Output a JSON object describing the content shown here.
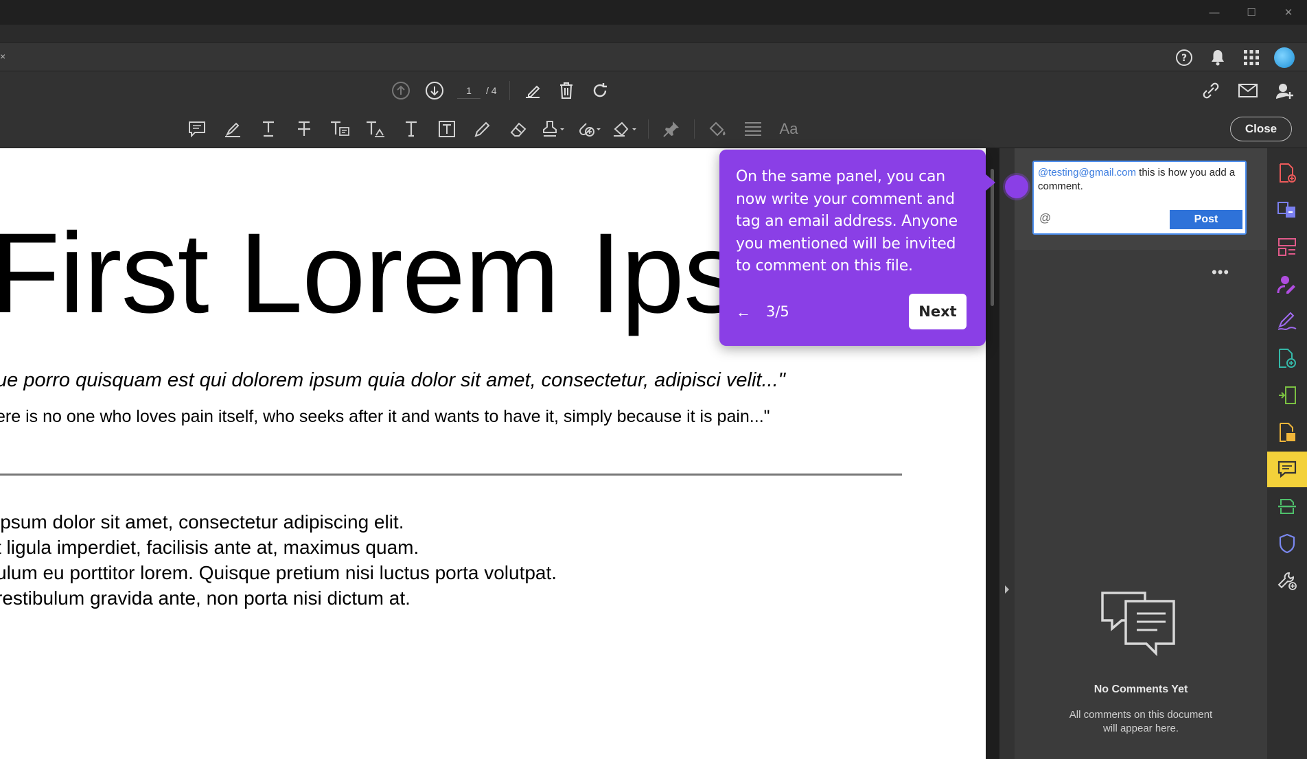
{
  "window": {
    "minimize": "—",
    "maximize": "☐",
    "close": "✕"
  },
  "tabbar": {
    "close_glyph": "×"
  },
  "pagenav": {
    "current_page": "1",
    "total_pages": "/ 4"
  },
  "toolbar": {
    "font_label": "Aa",
    "close_label": "Close"
  },
  "document": {
    "title": "First Lorem Ipsum",
    "quote_italic": "ue porro quisquam est qui dolorem ipsum quia dolor sit amet, consectetur, adipisci velit...\"",
    "quote_plain": "ere is no one who loves pain itself, who seeks after it and wants to have it, simply because it is pain...\"",
    "paragraph_lines": [
      "ipsum dolor sit amet, consectetur adipiscing elit.",
      "t ligula imperdiet, facilisis ante at, maximus quam.",
      "ulum eu porttitor lorem. Quisque pretium nisi luctus porta volutpat.",
      "restibulum gravida ante, non porta nisi dictum at."
    ]
  },
  "comment": {
    "mention": "@testing@gmail.com",
    "text": " this is how you add a comment.",
    "at_symbol": "@",
    "post_label": "Post",
    "more_label": "•••",
    "empty_title": "No Comments Yet",
    "empty_subtitle": "All comments on this document will appear here."
  },
  "tour": {
    "text": "On the same panel, you can now write your comment and tag an email address. Anyone you mentioned will be invited to comment on this file.",
    "back_glyph": "←",
    "step": "3/5",
    "next_label": "Next"
  },
  "colors": {
    "tour_purple": "#8a3fe6",
    "post_blue": "#2e72d9",
    "active_rail": "#f3d13a"
  },
  "icons": {
    "top_right": [
      "help-icon",
      "bell-icon",
      "apps-grid-icon",
      "avatar"
    ],
    "nav": [
      "page-up-icon",
      "page-down-icon",
      "sign-icon",
      "trash-icon",
      "rotate-icon"
    ],
    "nav_right": [
      "share-link-icon",
      "email-icon",
      "add-user-icon"
    ],
    "annotation": [
      "comment-icon",
      "highlight-icon",
      "underline-text-icon",
      "strikethrough-icon",
      "replace-text-icon",
      "insert-text-icon",
      "add-text-icon",
      "text-box-icon",
      "pencil-icon",
      "eraser-icon",
      "stamp-icon",
      "attach-icon",
      "shapes-icon",
      "pin-icon",
      "fill-icon",
      "line-weight-icon"
    ],
    "rail": [
      "create-pdf-icon",
      "export-pdf-icon",
      "organize-pages-icon",
      "request-sign-icon",
      "fill-sign-icon",
      "edit-pdf-icon",
      "compress-icon",
      "redact-icon",
      "comment-icon",
      "scan-icon",
      "protect-icon",
      "tools-icon"
    ]
  }
}
